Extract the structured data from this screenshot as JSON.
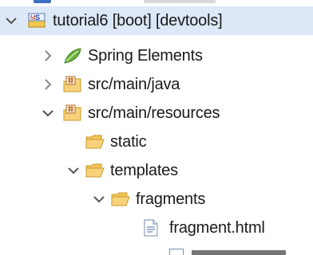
{
  "tree": {
    "project_label": "tutorial6 [boot] [devtools]",
    "spring_label": "Spring Elements",
    "java_label": "src/main/java",
    "resources_label": "src/main/resources",
    "static_label": "static",
    "templates_label": "templates",
    "fragments_label": "fragments",
    "fragment_file_label": "fragment.html"
  },
  "colors": {
    "folder_fill": "#f7d27a",
    "folder_stroke": "#c79a2a",
    "spring_green": "#6cb33f",
    "package_brown": "#b5651d",
    "chevron": "#555555",
    "selection": "#dde8f8"
  }
}
